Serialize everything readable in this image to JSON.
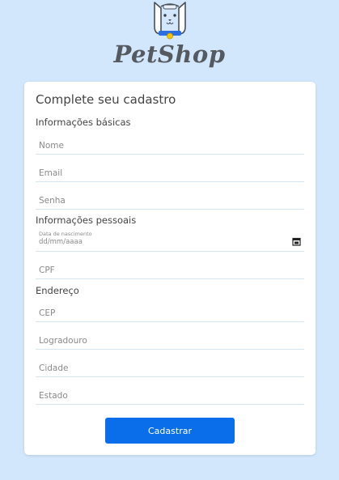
{
  "brand": {
    "name": "PetShop"
  },
  "form": {
    "title": "Complete seu cadastro",
    "sections": {
      "basic": "Informações básicas",
      "personal": "Informações pessoais",
      "address": "Endereço"
    },
    "fields": {
      "nome": "Nome",
      "email": "Email",
      "senha": "Senha",
      "nascimento_label": "Data de nascimento",
      "nascimento_placeholder": "dd/mm/aaaa",
      "cpf": "CPF",
      "cep": "CEP",
      "logradouro": "Logradouro",
      "cidade": "Cidade",
      "estado": "Estado"
    },
    "submit_label": "Cadastrar"
  },
  "colors": {
    "background": "#d2e6fc",
    "accent": "#0a6eea",
    "mascot_collar": "#2b6ee0",
    "mascot_tag": "#f5c400"
  },
  "icons": {
    "date_picker": "calendar-icon",
    "logo": "dog-mascot-icon"
  }
}
